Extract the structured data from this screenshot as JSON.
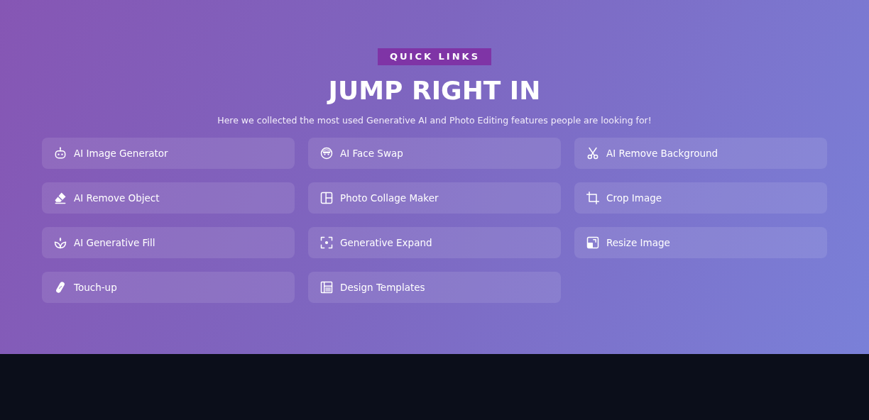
{
  "section": {
    "badge": "QUICK LINKS",
    "title": "JUMP RIGHT IN",
    "subtitle": "Here we collected the most used Generative AI and Photo Editing features people are looking for!"
  },
  "links": [
    {
      "label": "AI Image Generator"
    },
    {
      "label": "AI Face Swap"
    },
    {
      "label": "AI Remove Background"
    },
    {
      "label": "AI Remove Object"
    },
    {
      "label": "Photo Collage Maker"
    },
    {
      "label": "Crop Image"
    },
    {
      "label": "AI Generative Fill"
    },
    {
      "label": "Generative Expand"
    },
    {
      "label": "Resize Image"
    },
    {
      "label": "Touch-up"
    },
    {
      "label": "Design Templates"
    }
  ]
}
